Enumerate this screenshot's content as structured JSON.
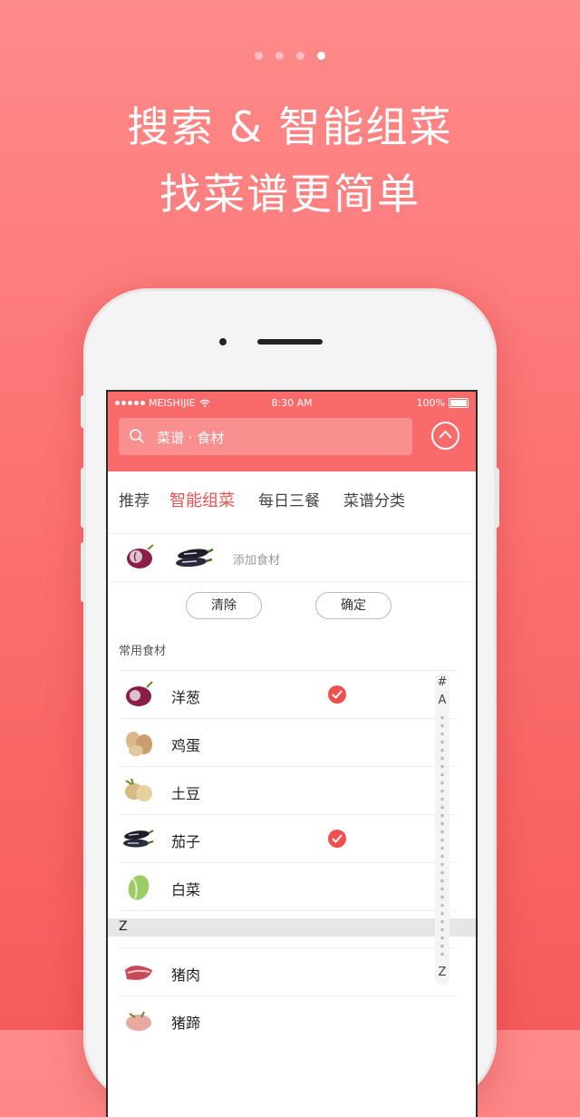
{
  "carousel": {
    "pages": 4,
    "active_index": 3
  },
  "headline": {
    "line1": "搜索 & 智能组菜",
    "line2": "找菜谱更简单"
  },
  "status_bar": {
    "carrier": "MEISHIJIE",
    "time": "8:30 AM",
    "battery": "100%"
  },
  "search": {
    "placeholder": "菜谱 · 食材"
  },
  "tabs": [
    {
      "label": "推荐",
      "active": false
    },
    {
      "label": "智能组菜",
      "active": true
    },
    {
      "label": "每日三餐",
      "active": false
    },
    {
      "label": "菜谱分类",
      "active": false
    }
  ],
  "selected": {
    "icons": [
      "onion-icon",
      "eggplant-icon"
    ],
    "add_label": "添加食材"
  },
  "buttons": {
    "clear": "清除",
    "confirm": "确定"
  },
  "section_title": "常用食材",
  "ingredients": [
    {
      "name": "洋葱",
      "icon": "onion-icon",
      "checked": true
    },
    {
      "name": "鸡蛋",
      "icon": "egg-icon",
      "checked": false
    },
    {
      "name": "土豆",
      "icon": "potato-icon",
      "checked": false
    },
    {
      "name": "茄子",
      "icon": "eggplant-icon",
      "checked": true
    },
    {
      "name": "白菜",
      "icon": "cabbage-icon",
      "checked": false
    }
  ],
  "z_header": "Z",
  "z_ingredients": [
    {
      "name": "猪肉",
      "icon": "pork-icon"
    },
    {
      "name": "猪蹄",
      "icon": "pig-trotter-icon"
    }
  ],
  "index_bar": {
    "top": "#",
    "first": "A",
    "last": "Z"
  },
  "colors": {
    "accent": "#f24f4f",
    "bar": "#f96a6a"
  }
}
